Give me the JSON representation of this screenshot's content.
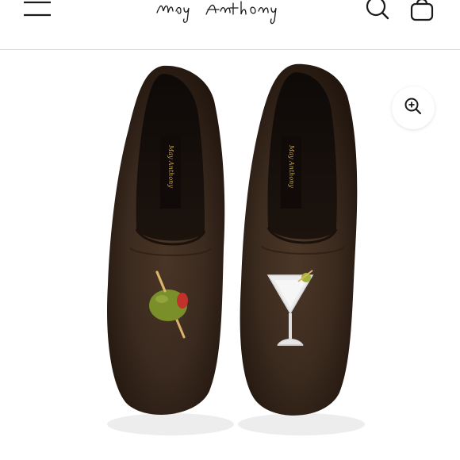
{
  "header": {
    "brand_name": "May Anthony",
    "icons": [
      "hamburger-menu-icon",
      "search-icon",
      "shopping-bag-icon"
    ]
  },
  "gallery": {
    "zoom_icon": "zoom-in-icon",
    "product": {
      "description": "",
      "left_motif": "olive-toothpick",
      "right_motif": "martini-glass",
      "insole_label": "May Anthony"
    },
    "colors": {
      "velvet": "#3a2a1f",
      "velvet_dark": "#24170f",
      "olive": "#7a8f2a",
      "pimento": "#c0322a",
      "toothpick": "#d9b46a",
      "glass": "#e8e8e8"
    }
  }
}
